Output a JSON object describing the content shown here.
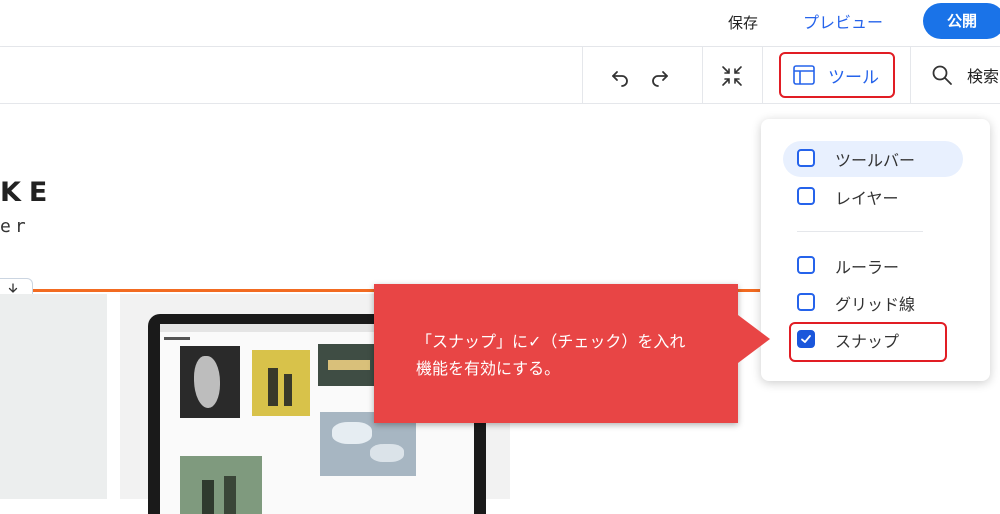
{
  "header": {
    "save_label": "保存",
    "preview_label": "プレビュー",
    "publish_label": "公開"
  },
  "toolbar": {
    "tools_label": "ツール",
    "search_label": "検索"
  },
  "canvas": {
    "heading_fragment": "KE",
    "subheading_fragment": "er"
  },
  "tools_menu": {
    "items": [
      {
        "label": "ツールバー",
        "checked": false
      },
      {
        "label": "レイヤー",
        "checked": false
      },
      {
        "label": "ルーラー",
        "checked": false
      },
      {
        "label": "グリッド線",
        "checked": false
      },
      {
        "label": "スナップ",
        "checked": true
      }
    ]
  },
  "callout": {
    "line1": "「スナップ」に✓（チェック）を入れ",
    "line2": "機能を有効にする。"
  },
  "colors": {
    "accent": "#1a73e8",
    "link": "#2563eb",
    "highlight_red": "#e11d24",
    "callout_bg": "#e84545",
    "divider_orange": "#f26b21"
  }
}
